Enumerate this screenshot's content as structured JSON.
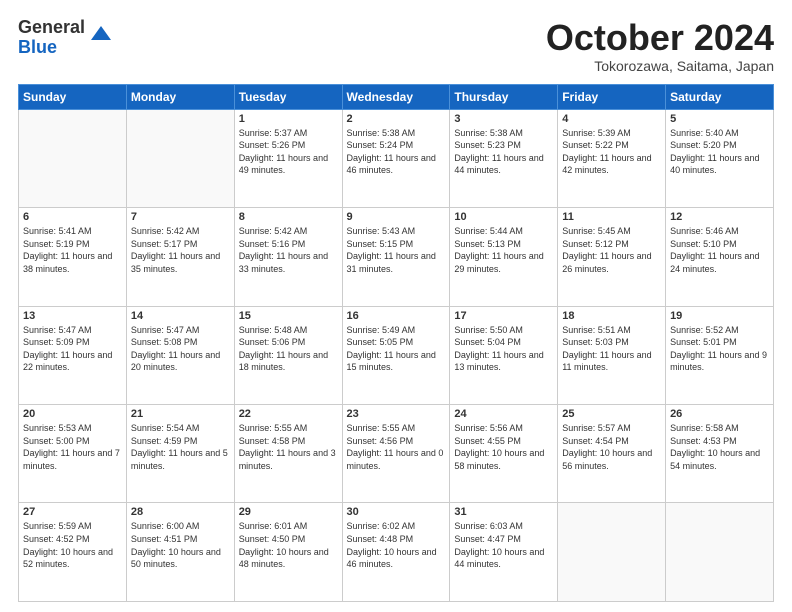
{
  "header": {
    "logo_line1": "General",
    "logo_line2": "Blue",
    "month_title": "October 2024",
    "location": "Tokorozawa, Saitama, Japan"
  },
  "calendar": {
    "days_of_week": [
      "Sunday",
      "Monday",
      "Tuesday",
      "Wednesday",
      "Thursday",
      "Friday",
      "Saturday"
    ],
    "weeks": [
      [
        {
          "day": "",
          "info": ""
        },
        {
          "day": "",
          "info": ""
        },
        {
          "day": "1",
          "info": "Sunrise: 5:37 AM\nSunset: 5:26 PM\nDaylight: 11 hours and 49 minutes."
        },
        {
          "day": "2",
          "info": "Sunrise: 5:38 AM\nSunset: 5:24 PM\nDaylight: 11 hours and 46 minutes."
        },
        {
          "day": "3",
          "info": "Sunrise: 5:38 AM\nSunset: 5:23 PM\nDaylight: 11 hours and 44 minutes."
        },
        {
          "day": "4",
          "info": "Sunrise: 5:39 AM\nSunset: 5:22 PM\nDaylight: 11 hours and 42 minutes."
        },
        {
          "day": "5",
          "info": "Sunrise: 5:40 AM\nSunset: 5:20 PM\nDaylight: 11 hours and 40 minutes."
        }
      ],
      [
        {
          "day": "6",
          "info": "Sunrise: 5:41 AM\nSunset: 5:19 PM\nDaylight: 11 hours and 38 minutes."
        },
        {
          "day": "7",
          "info": "Sunrise: 5:42 AM\nSunset: 5:17 PM\nDaylight: 11 hours and 35 minutes."
        },
        {
          "day": "8",
          "info": "Sunrise: 5:42 AM\nSunset: 5:16 PM\nDaylight: 11 hours and 33 minutes."
        },
        {
          "day": "9",
          "info": "Sunrise: 5:43 AM\nSunset: 5:15 PM\nDaylight: 11 hours and 31 minutes."
        },
        {
          "day": "10",
          "info": "Sunrise: 5:44 AM\nSunset: 5:13 PM\nDaylight: 11 hours and 29 minutes."
        },
        {
          "day": "11",
          "info": "Sunrise: 5:45 AM\nSunset: 5:12 PM\nDaylight: 11 hours and 26 minutes."
        },
        {
          "day": "12",
          "info": "Sunrise: 5:46 AM\nSunset: 5:10 PM\nDaylight: 11 hours and 24 minutes."
        }
      ],
      [
        {
          "day": "13",
          "info": "Sunrise: 5:47 AM\nSunset: 5:09 PM\nDaylight: 11 hours and 22 minutes."
        },
        {
          "day": "14",
          "info": "Sunrise: 5:47 AM\nSunset: 5:08 PM\nDaylight: 11 hours and 20 minutes."
        },
        {
          "day": "15",
          "info": "Sunrise: 5:48 AM\nSunset: 5:06 PM\nDaylight: 11 hours and 18 minutes."
        },
        {
          "day": "16",
          "info": "Sunrise: 5:49 AM\nSunset: 5:05 PM\nDaylight: 11 hours and 15 minutes."
        },
        {
          "day": "17",
          "info": "Sunrise: 5:50 AM\nSunset: 5:04 PM\nDaylight: 11 hours and 13 minutes."
        },
        {
          "day": "18",
          "info": "Sunrise: 5:51 AM\nSunset: 5:03 PM\nDaylight: 11 hours and 11 minutes."
        },
        {
          "day": "19",
          "info": "Sunrise: 5:52 AM\nSunset: 5:01 PM\nDaylight: 11 hours and 9 minutes."
        }
      ],
      [
        {
          "day": "20",
          "info": "Sunrise: 5:53 AM\nSunset: 5:00 PM\nDaylight: 11 hours and 7 minutes."
        },
        {
          "day": "21",
          "info": "Sunrise: 5:54 AM\nSunset: 4:59 PM\nDaylight: 11 hours and 5 minutes."
        },
        {
          "day": "22",
          "info": "Sunrise: 5:55 AM\nSunset: 4:58 PM\nDaylight: 11 hours and 3 minutes."
        },
        {
          "day": "23",
          "info": "Sunrise: 5:55 AM\nSunset: 4:56 PM\nDaylight: 11 hours and 0 minutes."
        },
        {
          "day": "24",
          "info": "Sunrise: 5:56 AM\nSunset: 4:55 PM\nDaylight: 10 hours and 58 minutes."
        },
        {
          "day": "25",
          "info": "Sunrise: 5:57 AM\nSunset: 4:54 PM\nDaylight: 10 hours and 56 minutes."
        },
        {
          "day": "26",
          "info": "Sunrise: 5:58 AM\nSunset: 4:53 PM\nDaylight: 10 hours and 54 minutes."
        }
      ],
      [
        {
          "day": "27",
          "info": "Sunrise: 5:59 AM\nSunset: 4:52 PM\nDaylight: 10 hours and 52 minutes."
        },
        {
          "day": "28",
          "info": "Sunrise: 6:00 AM\nSunset: 4:51 PM\nDaylight: 10 hours and 50 minutes."
        },
        {
          "day": "29",
          "info": "Sunrise: 6:01 AM\nSunset: 4:50 PM\nDaylight: 10 hours and 48 minutes."
        },
        {
          "day": "30",
          "info": "Sunrise: 6:02 AM\nSunset: 4:48 PM\nDaylight: 10 hours and 46 minutes."
        },
        {
          "day": "31",
          "info": "Sunrise: 6:03 AM\nSunset: 4:47 PM\nDaylight: 10 hours and 44 minutes."
        },
        {
          "day": "",
          "info": ""
        },
        {
          "day": "",
          "info": ""
        }
      ]
    ]
  }
}
